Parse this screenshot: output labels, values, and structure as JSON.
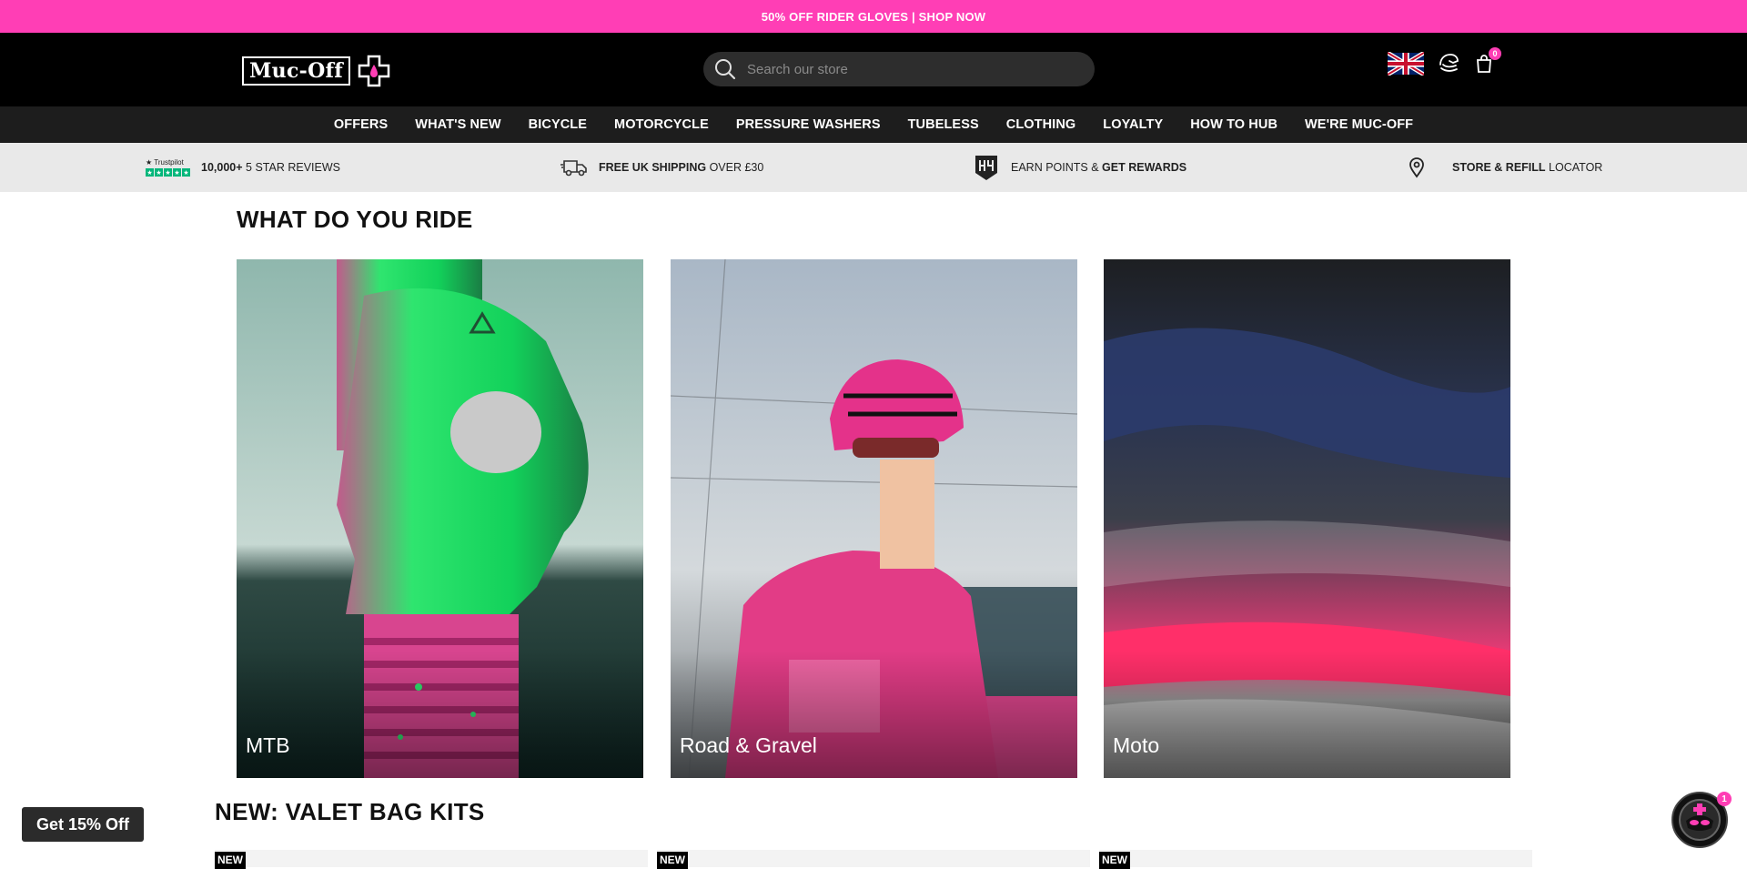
{
  "promo": {
    "text": "50% OFF RIDER GLOVES | SHOP NOW"
  },
  "header": {
    "logo_text": "Muc-Off",
    "search_placeholder": "Search our store",
    "cart_count": "0",
    "icons": [
      "uk-flag-icon",
      "account-icon",
      "cart-icon",
      "search-icon"
    ]
  },
  "nav": {
    "items": [
      "OFFERS",
      "WHAT'S NEW",
      "BICYCLE",
      "MOTORCYCLE",
      "PRESSURE WASHERS",
      "TUBELESS",
      "CLOTHING",
      "LOYALTY",
      "HOW TO HUB",
      "WE'RE MUC-OFF"
    ]
  },
  "usp": {
    "trustpilot_label": "Trustpilot",
    "reviews_bold": "10,000+",
    "reviews_text": "5 STAR REVIEWS",
    "shipping_bold": "FREE UK SHIPPING",
    "shipping_text": "OVER £30",
    "rewards_text": "EARN POINTS &",
    "rewards_bold": "GET REWARDS",
    "store_bold": "STORE & REFILL",
    "store_text": "LOCATOR"
  },
  "ride": {
    "title": "WHAT DO YOU RIDE",
    "cards": [
      {
        "label": "MTB"
      },
      {
        "label": "Road & Gravel"
      },
      {
        "label": "Moto"
      }
    ]
  },
  "valet": {
    "title": "NEW: VALET BAG KITS",
    "tags": [
      "NEW",
      "NEW",
      "NEW"
    ]
  },
  "popup": {
    "discount_label": "Get 15% Off"
  },
  "chat": {
    "badge": "1"
  },
  "colors": {
    "brand_pink": "#ff3eb5",
    "header_bg": "#000000",
    "nav_bg": "#1d1d1d",
    "usp_bg": "#e9e9e9",
    "trustpilot_green": "#00b67a"
  }
}
